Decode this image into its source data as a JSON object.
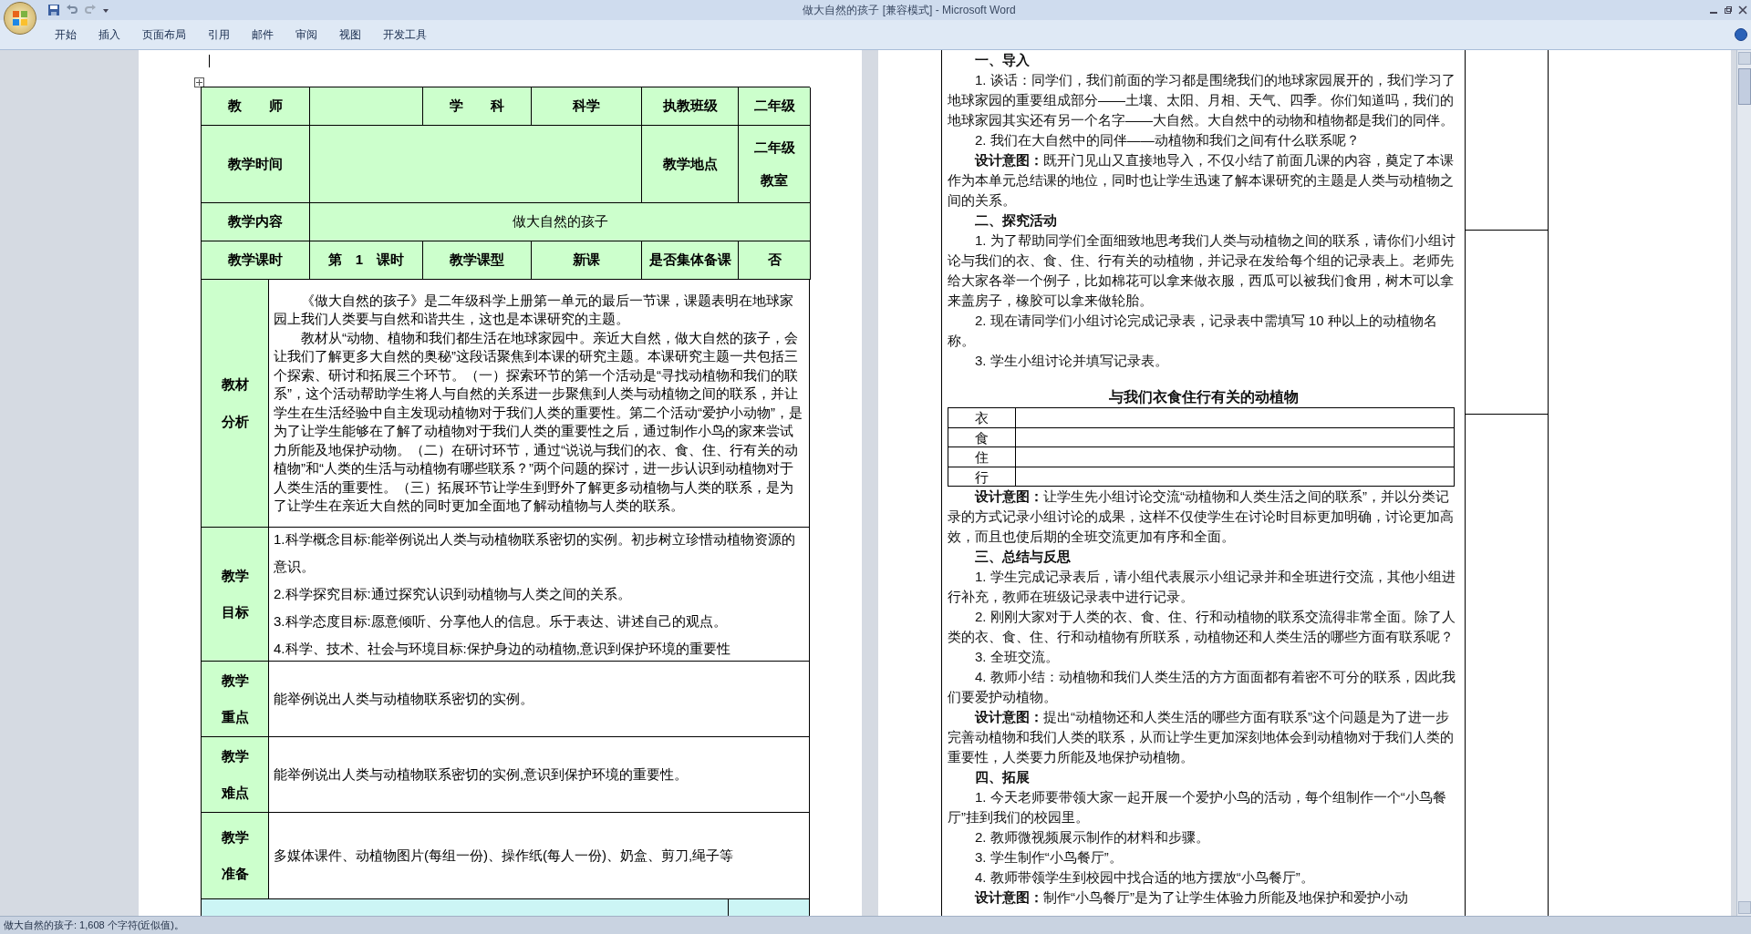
{
  "window": {
    "title": "做大自然的孩子 [兼容模式] - Microsoft Word"
  },
  "ribbon_tabs": [
    "开始",
    "插入",
    "页面布局",
    "引用",
    "邮件",
    "审阅",
    "视图",
    "开发工具"
  ],
  "lesson_table": {
    "header_rows": [
      {
        "cells": [
          {
            "kind": "heading",
            "text": "教　　师"
          },
          {
            "kind": "blank"
          },
          {
            "kind": "heading",
            "text": "学　　科"
          },
          {
            "kind": "heading",
            "text": "科学"
          },
          {
            "kind": "heading",
            "text": "执教班级"
          },
          {
            "kind": "heading",
            "text": "二年级"
          }
        ]
      },
      {
        "cells": [
          {
            "kind": "heading",
            "text": "教学时间"
          },
          {
            "kind": "blank"
          },
          {
            "kind": "heading",
            "text": "教学地点"
          },
          {
            "kind": "heading",
            "lines": [
              "二年级",
              "教室"
            ]
          }
        ]
      },
      {
        "cells": [
          {
            "kind": "heading",
            "text": "教学内容"
          },
          {
            "kind": "plain",
            "text": "做大自然的孩子"
          }
        ]
      },
      {
        "cells": [
          {
            "kind": "heading",
            "text": "教学课时"
          },
          {
            "kind": "heading",
            "text": "第　1　课时"
          },
          {
            "kind": "heading",
            "text": "教学课型"
          },
          {
            "kind": "heading",
            "text": "新课"
          },
          {
            "kind": "heading",
            "text": "是否集体备课"
          },
          {
            "kind": "heading",
            "text": "否"
          }
        ]
      }
    ],
    "section_rows": [
      {
        "label_lines": [
          "教材",
          "分析"
        ],
        "indent": true,
        "paragraphs": [
          "《做大自然的孩子》是二年级科学上册第一单元的最后一节课，课题表明在地球家园上我们人类要与自然和谐共生，这也是本课研究的主题。",
          "教材从“动物、植物和我们都生活在地球家园中。亲近大自然，做大自然的孩子，会让我们了解更多大自然的奥秘”这段话聚焦到本课的研究主题。本课研究主题一共包括三个探索、研讨和拓展三个环节。（一）探索环节的第一个活动是“寻找动植物和我们的联系”，这个活动帮助学生将人与自然的关系进一步聚焦到人类与动植物之间的联系，并让学生在生活经验中自主发现动植物对于我们人类的重要性。第二个活动“爱护小动物”，是为了让学生能够在了解了动植物对于我们人类的重要性之后，通过制作小鸟的家来尝试力所能及地保护动物。（二）在研讨环节，通过“说说与我们的衣、食、住、行有关的动植物”和“人类的生活与动植物有哪些联系？”两个问题的探讨，进一步认识到动植物对于人类生活的重要性。（三）拓展环节让学生到野外了解更多动植物与人类的联系，是为了让学生在亲近大自然的同时更加全面地了解动植物与人类的联系。"
        ]
      },
      {
        "label_lines": [
          "教学",
          "目标"
        ],
        "indent": false,
        "paragraphs": [
          "1.科学概念目标:能举例说出人类与动植物联系密切的实例。初步树立珍惜动植物资源的意识。",
          "2.科学探究目标:通过探究认识到动植物与人类之间的关系。",
          "3.科学态度目标:愿意倾听、分享他人的信息。乐于表达、讲述自己的观点。",
          "4.科学、技术、社会与环境目标:保护身边的动植物,意识到保护环境的重要性"
        ]
      },
      {
        "label_lines": [
          "教学",
          "重点"
        ],
        "indent": false,
        "paragraphs": [
          "能举例说出人类与动植物联系密切的实例。"
        ]
      },
      {
        "label_lines": [
          "教学",
          "难点"
        ],
        "indent": false,
        "paragraphs": [
          "能举例说出人类与动植物联系密切的实例,意识到保护环境的重要性。"
        ]
      },
      {
        "label_lines": [
          "教学",
          "准备"
        ],
        "indent": false,
        "paragraphs": [
          "多媒体课件、动植物图片(每组一份)、操作纸(每人一份)、奶盒、剪刀,绳子等"
        ]
      }
    ]
  },
  "lesson_plan": [
    {
      "kind": "heading",
      "text": "一、导入"
    },
    {
      "kind": "para",
      "text": "1. 谈话：同学们，我们前面的学习都是围绕我们的地球家园展开的，我们学习了地球家园的重要组成部分——土壤、太阳、月相、天气、四季。你们知道吗，我们的地球家园其实还有另一个名字——大自然。大自然中的动物和植物都是我们的同伴。"
    },
    {
      "kind": "para",
      "text": "2. 我们在大自然中的同伴——动植物和我们之间有什么联系呢？"
    },
    {
      "kind": "para",
      "text": "**设计意图：**既开门见山又直接地导入，不仅小结了前面几课的内容，奠定了本课作为本单元总结课的地位，同时也让学生迅速了解本课研究的主题是人类与动植物之间的关系。"
    },
    {
      "kind": "heading",
      "text": "二、探究活动"
    },
    {
      "kind": "para",
      "text": "1. 为了帮助同学们全面细致地思考我们人类与动植物之间的联系，请你们小组讨论与我们的衣、食、住、行有关的动植物，并记录在发给每个组的记录表上。老师先给大家各举一个例子，比如棉花可以拿来做衣服，西瓜可以被我们食用，树木可以拿来盖房子，橡胶可以拿来做轮胎。"
    },
    {
      "kind": "para",
      "text": "2. 现在请同学们小组讨论完成记录表，记录表中需填写 10 种以上的动植物名称。"
    },
    {
      "kind": "para",
      "text": "3. 学生小组讨论并填写记录表。"
    },
    {
      "kind": "table",
      "title": "与我们衣食住行有关的动植物",
      "rows": [
        "衣",
        "食",
        "住",
        "行"
      ]
    },
    {
      "kind": "para",
      "text": "**设计意图：**让学生先小组讨论交流“动植物和人类生活之间的联系”，并以分类记录的方式记录小组讨论的成果，这样不仅使学生在讨论时目标更加明确，讨论更加高效，而且也使后期的全班交流更加有序和全面。"
    },
    {
      "kind": "heading",
      "text": "三、总结与反思"
    },
    {
      "kind": "para",
      "text": "1. 学生完成记录表后，请小组代表展示小组记录并和全班进行交流，其他小组进行补充，教师在班级记录表中进行记录。"
    },
    {
      "kind": "para",
      "text": "2. 刚刚大家对于人类的衣、食、住、行和动植物的联系交流得非常全面。除了人类的衣、食、住、行和动植物有所联系，动植物还和人类生活的哪些方面有联系呢？"
    },
    {
      "kind": "para",
      "text": "3. 全班交流。"
    },
    {
      "kind": "para",
      "text": "4. 教师小结：动植物和我们人类生活的方方面面都有着密不可分的联系，因此我们要爱护动植物。"
    },
    {
      "kind": "para",
      "text": "**设计意图：**提出“动植物还和人类生活的哪些方面有联系”这个问题是为了进一步完善动植物和我们人类的联系，从而让学生更加深刻地体会到动植物对于我们人类的重要性，人类要力所能及地保护动植物。"
    },
    {
      "kind": "heading",
      "text": "四、拓展"
    },
    {
      "kind": "para",
      "text": "1. 今天老师要带领大家一起开展一个爱护小鸟的活动，每个组制作一个“小鸟餐厅”挂到我们的校园里。"
    },
    {
      "kind": "para",
      "text": "2. 教师微视频展示制作的材料和步骤。"
    },
    {
      "kind": "para",
      "text": "3. 学生制作“小鸟餐厅”。"
    },
    {
      "kind": "para",
      "text": "4. 教师带领学生到校园中找合适的地方摆放“小鸟餐厅”。"
    },
    {
      "kind": "para",
      "text": "**设计意图：**制作“小鸟餐厅”是为了让学生体验力所能及地保护和爱护小动"
    }
  ],
  "status_bar": {
    "text": "做大自然的孩子: 1,608 个字符(近似值)。"
  }
}
